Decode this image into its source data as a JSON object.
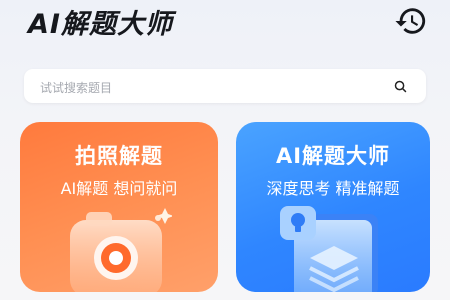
{
  "header": {
    "app_title": "AI解题大师",
    "history_icon": "history-icon"
  },
  "search": {
    "placeholder": "试试搜索题目",
    "icon": "search-icon"
  },
  "cards": [
    {
      "title": "拍照解题",
      "subtitle": "AI解题  想问就问",
      "icon": "camera-icon",
      "color": "#ff8a4a"
    },
    {
      "title": "AI解题大师",
      "subtitle": "深度思考  精准解题",
      "icon": "book-lightbulb-icon",
      "color": "#3a8eff"
    }
  ]
}
